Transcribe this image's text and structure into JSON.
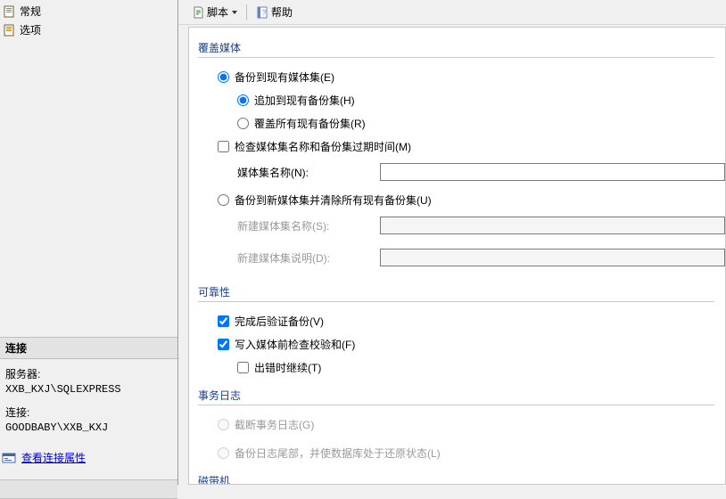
{
  "left": {
    "pages": [
      {
        "label": "常规",
        "icon": "page-icon"
      },
      {
        "label": "选项",
        "icon": "page-icon"
      }
    ],
    "connection": {
      "header": "连接",
      "server_label": "服务器:",
      "server_value": "XXB_KXJ\\SQLEXPRESS",
      "conn_label": "连接:",
      "conn_value": "GOODBABY\\XXB_KXJ",
      "view_props": "查看连接属性"
    }
  },
  "toolbar": {
    "script_label": "脚本",
    "help_label": "帮助"
  },
  "sections": {
    "overwrite_title": "覆盖媒体",
    "reliability_title": "可靠性",
    "tlog_title": "事务日志",
    "tape_title": "磁带机"
  },
  "overwrite": {
    "opt_existing": "备份到现有媒体集(E)",
    "sub_append": "追加到现有备份集(H)",
    "sub_overwrite_all": "覆盖所有现有备份集(R)",
    "check_media": "检查媒体集名称和备份集过期时间(M)",
    "media_name_label": "媒体集名称(N):",
    "media_name_value": "",
    "opt_new": "备份到新媒体集并清除所有现有备份集(U)",
    "new_name_label": "新建媒体集名称(S):",
    "new_name_value": "",
    "new_desc_label": "新建媒体集说明(D):",
    "new_desc_value": ""
  },
  "reliability": {
    "verify": "完成后验证备份(V)",
    "checksum": "写入媒体前检查校验和(F)",
    "continue_err": "出错时继续(T)"
  },
  "tlog": {
    "truncate": "截断事务日志(G)",
    "tail": "备份日志尾部，并使数据库处于还原状态(L)"
  }
}
